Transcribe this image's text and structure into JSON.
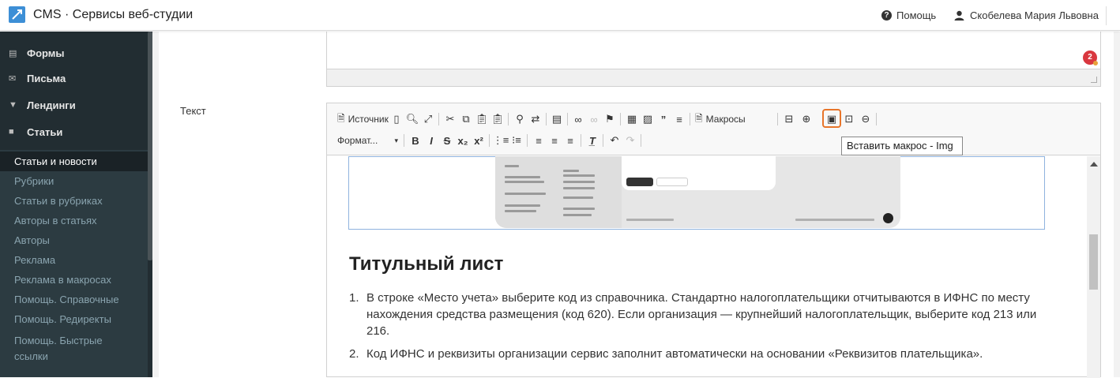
{
  "header": {
    "app_title": "CMS · Сервисы веб-студии",
    "help_label": "Помощь",
    "user_name": "Скобелева Мария Львовна",
    "accent": "#3d8fd6"
  },
  "sidebar": {
    "sections": [
      {
        "label": "Формы",
        "icon": "database-icon"
      },
      {
        "label": "Письма",
        "icon": "envelope-icon"
      },
      {
        "label": "Лендинги",
        "icon": "filter-icon"
      },
      {
        "label": "Статьи",
        "icon": "book-icon"
      }
    ],
    "items": [
      {
        "label": "Статьи и новости",
        "active": true
      },
      {
        "label": "Рубрики"
      },
      {
        "label": "Статьи в рубриках"
      },
      {
        "label": "Авторы в статьях"
      },
      {
        "label": "Авторы"
      },
      {
        "label": "Реклама"
      },
      {
        "label": "Реклама в макросах"
      },
      {
        "label": "Помощь. Справочные"
      },
      {
        "label": "Помощь. Редиректы"
      },
      {
        "label": "Помощь. Быстрые ссылки"
      }
    ]
  },
  "notification_count": "2",
  "field": {
    "label": "Текст"
  },
  "toolbar": {
    "source_label": "Источник",
    "macros_label": "Макросы",
    "format_label": "Формат...",
    "tooltip": "Вставить макрос - Img"
  },
  "editor": {
    "heading": "Титульный лист",
    "list": [
      {
        "num": "1.",
        "text": "В строке «Место учета» выберите код из справочника. Стандартно налогоплательщики отчитываются в ИФНС по месту нахождения средства размещения (код 620). Если организация — крупнейший налогоплательщик, выберите код 213 или 216."
      },
      {
        "num": "2.",
        "text": "Код ИФНС и реквизиты организации сервис заполнит автоматически на основании «Реквизитов плательщика»."
      }
    ]
  }
}
